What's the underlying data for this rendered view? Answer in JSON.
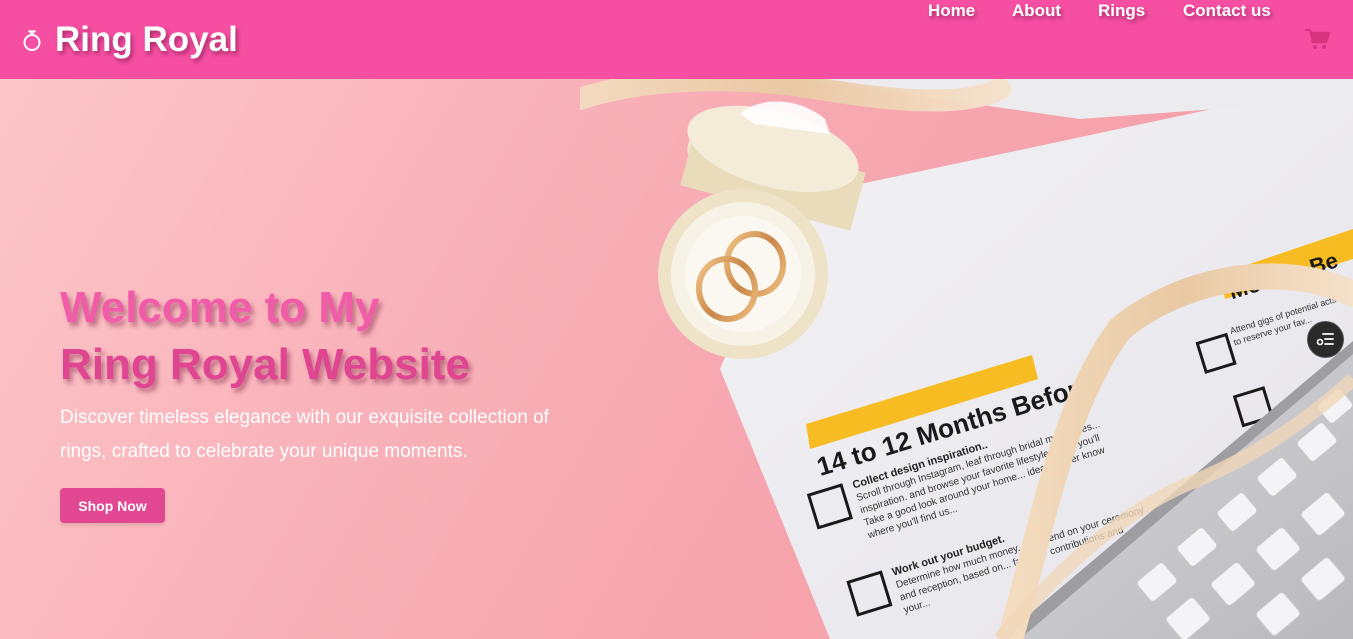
{
  "brand": {
    "name": "Ring Royal",
    "icon": "ring-icon"
  },
  "nav": {
    "items": [
      {
        "label": "Home"
      },
      {
        "label": "About"
      },
      {
        "label": "Rings"
      },
      {
        "label": "Contact us"
      }
    ],
    "cart_icon": "cart-icon"
  },
  "hero": {
    "headline_line1": "Welcome to My",
    "headline_line2": "Ring Royal Website",
    "subtext": "Discover timeless elegance with our exquisite collection of rings, crafted to celebrate your unique moments.",
    "cta_label": "Shop Now",
    "photo": {
      "checklist_heading": "14 to 12 Months Before",
      "checklist_heading_right": "Months Be",
      "checklist_items": [
        {
          "title": "Collect design inspiration..",
          "text": "Scroll through Instagram, leaf through bridal magazines... inspiration. and browse your favorite lifestyle and... you'll Take a good look around your home... ideas. never know where you'll find us..."
        },
        {
          "title": "Work out your budget.",
          "text": "Determine how much money... to spend on your ceremony and reception, based on... families' contributions and your..."
        }
      ],
      "right_item": "Attend gigs of potential acts to reserve your fav..."
    }
  },
  "colors": {
    "header": "#f64fa2",
    "headline": "#f05ca7",
    "button": "#e24791"
  },
  "widget": {
    "icon": "settings-list-icon"
  }
}
